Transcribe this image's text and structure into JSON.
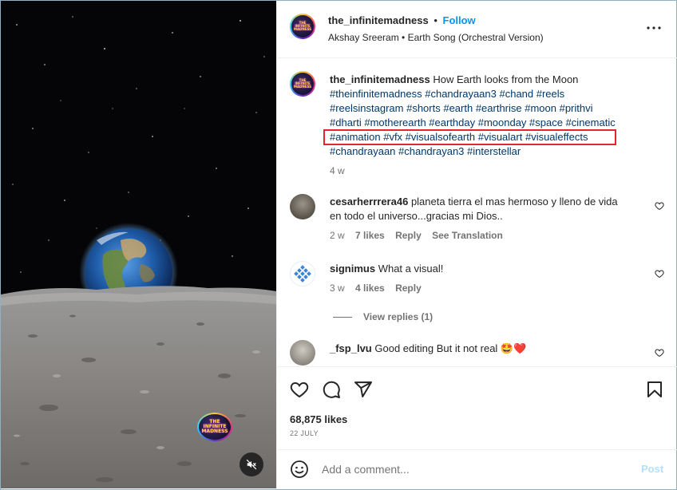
{
  "post": {
    "username": "the_infinitemadness",
    "follow_label": "Follow",
    "separator": "•",
    "audio": "Akshay Sreeram • Earth Song (Orchestral Version)",
    "more_icon": "more-horizontal-icon",
    "avatar_text": "THE INFINITE MADNESS"
  },
  "caption": {
    "username": "the_infinitemadness",
    "text": "How Earth looks from the Moon",
    "tags_line1": "#theinfinitemadness #chandrayaan3 #chand #reels",
    "tags_line2": "#reelsinstagram #shorts #earth #earthrise #moon #prithvi",
    "tags_line3": "#dharti #motherearth #earthday #moonday #space #cinematic",
    "tags_line4": "#animation #vfx #visualsofearth #visualart #visualeffects",
    "tags_line5": "#chandrayaan #chandrayan3 #interstellar",
    "time": "4 w",
    "highlight_color": "#e3262e"
  },
  "comments": [
    {
      "username": "cesarherrrera46",
      "text_line1": "planeta tierra el mas hermoso y lleno de vida",
      "text_line2": "en todo el universo...gracias mi Dios..",
      "time": "2 w",
      "likes": "7 likes",
      "reply": "Reply",
      "translate": "See Translation"
    },
    {
      "username": "signimus",
      "text": "What a visual!",
      "time": "3 w",
      "likes": "4 likes",
      "reply": "Reply",
      "view_replies": "View replies (1)"
    },
    {
      "username": "_fsp_lvu",
      "text": "Good editing But it not real 🤩❤️"
    }
  ],
  "actions": {
    "likes": "68,875 likes",
    "date": "22 JULY",
    "icons": [
      "heart-icon",
      "comment-icon",
      "share-icon",
      "bookmark-icon"
    ]
  },
  "compose": {
    "placeholder": "Add a comment...",
    "post_label": "Post"
  },
  "colors": {
    "link_blue": "#0095f6",
    "hashtag": "#00376b",
    "muted": "#737373",
    "post_disabled": "#b2dffc"
  }
}
